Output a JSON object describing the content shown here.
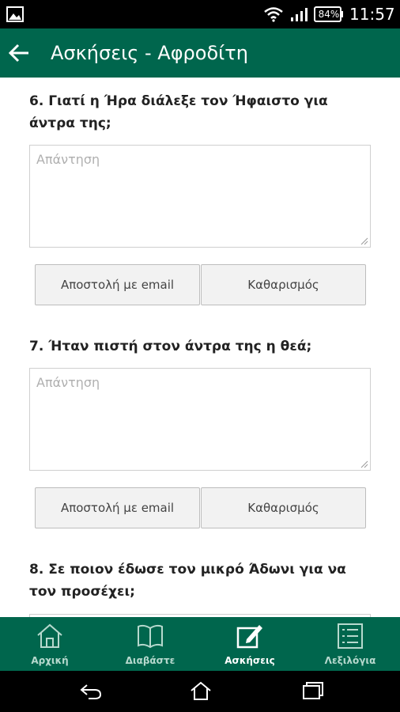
{
  "status_bar": {
    "battery": "84%",
    "time": "11:57"
  },
  "app_bar": {
    "title": "Ασκήσεις - Αφροδίτη",
    "back_icon": "arrow-left-icon"
  },
  "questions": [
    {
      "text": "6. Γιατί η Ήρα διάλεξε τον Ήφαιστο για άντρα της;",
      "answer_placeholder": "Απάντηση",
      "answer_value": "",
      "send_label": "Αποστολή με email",
      "clear_label": "Καθαρισμός"
    },
    {
      "text": "7. Ήταν πιστή στον άντρα της η θεά;",
      "answer_placeholder": "Απάντηση",
      "answer_value": "",
      "send_label": "Αποστολή με email",
      "clear_label": "Καθαρισμός"
    },
    {
      "text": "8. Σε ποιον έδωσε τον μικρό Άδωνι για να τον προσέχει;"
    }
  ],
  "bottom_nav": {
    "items": [
      {
        "label": "Αρχική",
        "icon": "home-icon",
        "active": false
      },
      {
        "label": "Διαβάστε",
        "icon": "book-icon",
        "active": false
      },
      {
        "label": "Ασκήσεις",
        "icon": "edit-icon",
        "active": true
      },
      {
        "label": "Λεξιλόγια",
        "icon": "list-icon",
        "active": false
      }
    ]
  },
  "colors": {
    "brand": "#00664d",
    "status_bar": "#000000"
  }
}
